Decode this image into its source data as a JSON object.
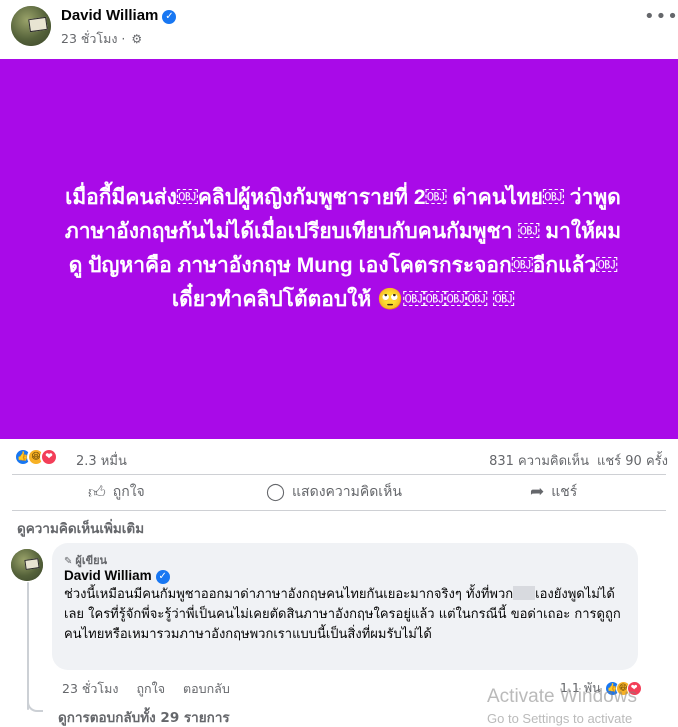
{
  "post": {
    "author": "David William",
    "time": "23 ชั่วโมง",
    "privacy_icon": "gear-icon",
    "more_icon": "more-icon"
  },
  "card": {
    "background": "#a90ae8",
    "text": "เมื่อกี้มีคนส่ง￼คลิปผู้หญิงกัมพูชารายที่ 2￼ ด่าคนไทย￼ ว่าพูดภาษาอังกฤษกันไม่ได้เมื่อเปรียบเทียบกับคนกัมพูชา ￼ มาให้ผมดู ปัญหาคือ ภาษาอังกฤษ Mung เองโคตรกระจอก￼อีกแล้ว￼เดี๋ยวทำคลิปโต้ตอบให้ 🙄￼￼￼￼ ￼"
  },
  "reactions": {
    "icons": [
      "like-icon",
      "haha-icon",
      "love-icon"
    ],
    "count": "2.3 หมื่น",
    "comments": "831 ความคิดเห็น",
    "shares": "แชร์ 90 ครั้ง"
  },
  "actions": {
    "like": "ถูกใจ",
    "comment": "แสดงความคิดเห็น",
    "share": "แชร์"
  },
  "more_comments": "ดูความคิดเห็นเพิ่มเติม",
  "comment": {
    "badge": "ผู้เขียน",
    "author": "David William",
    "text_part1": "ช่วงนี้เหมือนมีคนกัมพูชาออกมาด่าภาษาอังกฤษคนไทยกันเยอะมากจริงๆ ทั้งที่พวก",
    "text_part2": "เองยังพูดไม่ได้เลย ￼￼ใครที่รู้จักพี่จะรู้ว่าพี่เป็นคนไม่เคยตัดสินภาษาอังกฤษใครอยู่แล้ว แต่ในกรณีนี้  ขอด่าเถอะ การดูถูกคนไทย￼หรือเหมารวม￼ภาษาอังกฤษพวกเราแบบนี้เป็นสิ่งที่ผมรับไม่ได้ ￼￼￼",
    "time": "23 ชั่วโมง",
    "like": "ถูกใจ",
    "reply": "ตอบกลับ",
    "reaction_count": "1.1 พัน"
  },
  "replies": "ดูการตอบกลับทั้ง 29 รายการ",
  "watermark": {
    "line1": "Activate Windows",
    "line2": "Go to Settings to activate Windows."
  }
}
